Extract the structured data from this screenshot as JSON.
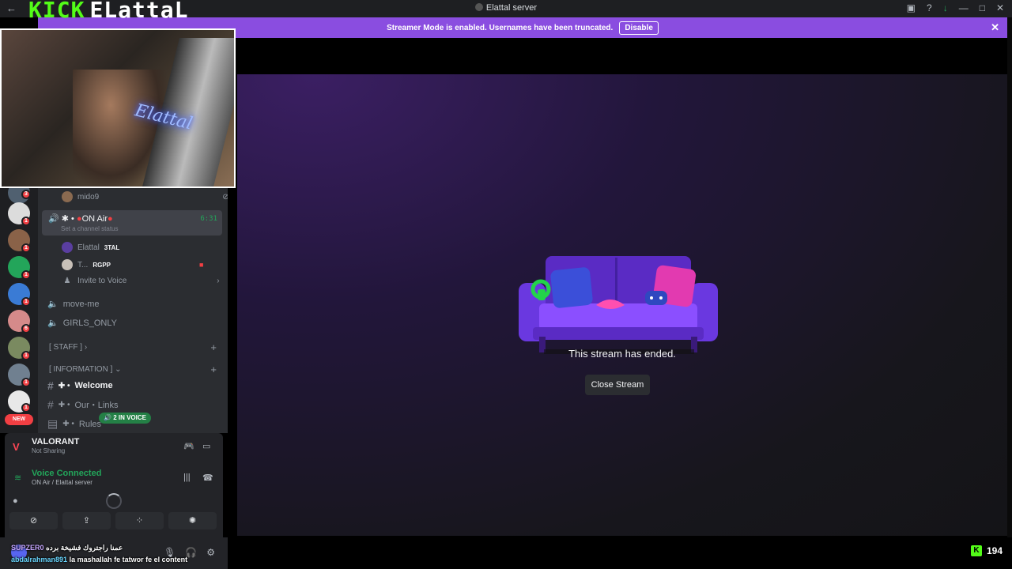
{
  "window": {
    "title": "Elattal server"
  },
  "overlay_logo": {
    "kick": "KICK",
    "name": "ELattaL"
  },
  "banner": {
    "text": "Streamer Mode is enabled. Usernames have been truncated.",
    "disable_label": "Disable"
  },
  "rail": {
    "badges": [
      "3",
      "1",
      "1",
      "1",
      "1",
      "6",
      "1",
      "1",
      "1"
    ],
    "new_label": "NEW"
  },
  "channels": {
    "voice_user_top": "mido9",
    "on_air_channel": "ON Air",
    "on_air_time": "6:31",
    "channel_status": "Set a channel status",
    "members": [
      {
        "name": "Elattal",
        "tag": "3TAL"
      },
      {
        "name": "T...",
        "tag": "RGPP"
      }
    ],
    "invite_label": "Invite to Voice",
    "move_me": "move-me",
    "girls_only": "GIRLS_ONLY",
    "category_staff": "[ STAFF ]",
    "category_information": "[ INFORMATION ]",
    "welcome": "Welcome",
    "our_links": "Our・Links",
    "rules": "Rules",
    "in_voice_badge": "2 IN VOICE"
  },
  "panel": {
    "game_name": "VALORANT",
    "game_status": "Not Sharing",
    "voice_connected": "Voice Connected",
    "voice_location": "ON Air / Elattal server"
  },
  "chat_overlay": [
    {
      "user": "SUPZER0",
      "message": "عمنا راجتروك فشيخة برده"
    },
    {
      "user": "abdalrahman891",
      "message": "la mashallah fe tatwor fe el content"
    }
  ],
  "stream": {
    "ended_text": "This stream has ended.",
    "close_label": "Close Stream"
  },
  "viewer_count": "194",
  "colors": {
    "accent_purple": "#8a4de0",
    "kick_green": "#53fc18",
    "online_green": "#23a55a",
    "badge_red": "#f23f43"
  }
}
